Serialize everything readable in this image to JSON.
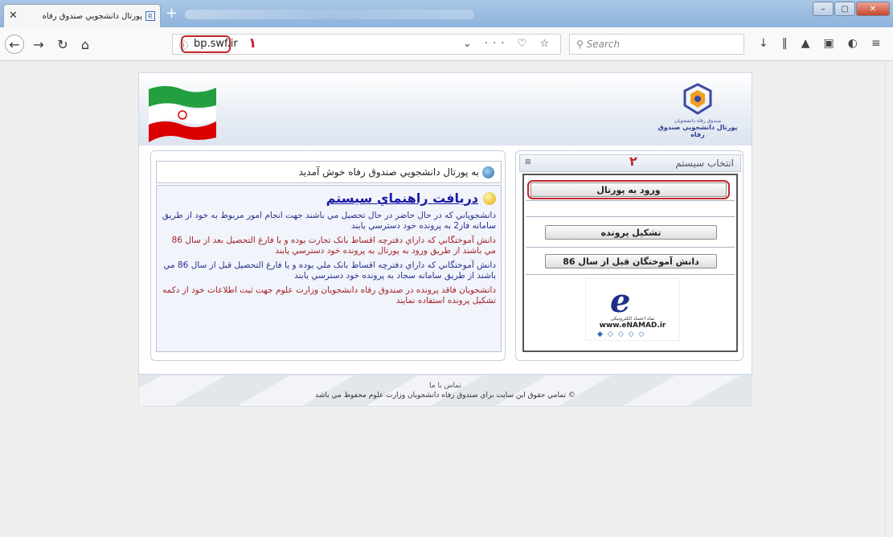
{
  "browser": {
    "tab_title": "پورتال دانشجويي صندوق رفاه",
    "tab_close": "✕",
    "new_tab": "+",
    "url": "bp.swf.ir",
    "annotation_1": "۱",
    "search_placeholder": "Search",
    "urlbar_tools": "⌄ ··· ♡ ☆"
  },
  "header": {
    "logo_small_text": "صندوق رفاه دانشجويان",
    "logo_title": "پورتال دانشجويي صندوق رفاه"
  },
  "left": {
    "welcome": "به پورتال دانشجويي صندوق رفاه خوش آمديد",
    "guide_link": "دريافت راهنماي سيستم",
    "paragraphs": [
      {
        "text": "دانشجوياني كه در حال حاضر در حال تحصيل مي باشند جهت انجام امور مربوط به خود از طريق سامانه فاز2 به پرونده خود دسترسي يابند",
        "color": "blue"
      },
      {
        "text": "دانش آموختگاني كه داراي دفترچه اقساط بانک تجارت بوده و يا فارغ التحصيل بعد از سال 86 مي باشند از طريق ورود به پورتال به پرونده خود دسترسي يابند",
        "color": "red"
      },
      {
        "text": "دانش آموختگاني كه داراي دفترچه اقساط بانک ملي بوده و يا فارغ التحصيل قبل از سال 86 مي باشند از طريق سامانه سجاد به پرونده خود دسترسي يابند",
        "color": "blue"
      },
      {
        "text": "دانشجويان فاقد پرونده در صندوق رفاه دانشجويان وزارت علوم جهت ثبت اطلاعات خود از دكمه تشكيل پرونده استفاده نمايند",
        "color": "red"
      }
    ]
  },
  "right": {
    "title": "انتخاب سيستم",
    "annotation_2": "۲",
    "btn_login": "ورود به پورتال",
    "btn_create": "تشكيل پرونده",
    "btn_alumni": "دانش آموختگان قبل از سال 86",
    "enamad_small": "نماد اعتماد الکترونیکی",
    "enamad_url": "www.eNAMAD.ir"
  },
  "footer": {
    "contact": "تماس با ما",
    "copyright": "© تمامي حقوق اين سايت براي صندوق رفاه دانشجويان وزارت علوم محفوظ مي باشد"
  },
  "colors": {
    "accent_red": "#c0262c",
    "link_blue": "#1a1aa6"
  }
}
